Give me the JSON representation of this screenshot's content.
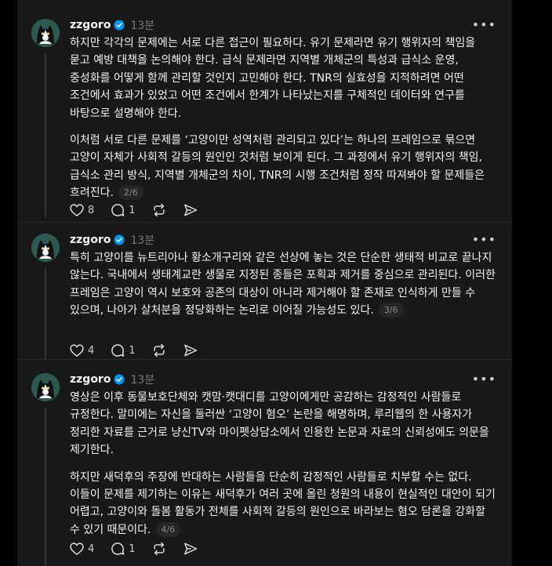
{
  "posts": [
    {
      "username": "zzgoro",
      "time": "13분",
      "paragraphs": [
        "하지만 각각의 문제에는 서로 다른 접근이 필요하다. 유기 문제라면 유기 행위자의 책임을 묻고 예방 대책을 논의해야 한다. 급식 문제라면 지역별 개체군의 특성과 급식소 운영, 중성화를 어떻게 함께 관리할 것인지 고민해야 한다. TNR의 실효성을 지적하려면 어떤 조건에서 효과가 있었고 어떤 조건에서 한계가 나타났는지를 구체적인 데이터와 연구를 바탕으로 설명해야 한다.",
        "이처럼 서로 다른 문제를 ‘고양이만 성역처럼 관리되고 있다’는 하나의 프레임으로 묶으면 고양이 자체가 사회적 갈등의 원인인 것처럼 보이게 된다. 그 과정에서 유기 행위자의 책임, 급식소 관리 방식, 지역별 개체군의 차이, TNR의 시행 조건처럼 정작 따져봐야 할 문제들은 흐려진다."
      ],
      "page": "2/6",
      "likes": "8",
      "replies": "1"
    },
    {
      "username": "zzgoro",
      "time": "13분",
      "paragraphs": [
        "특히 고양이를 뉴트리아나 황소개구리와 같은 선상에 놓는 것은 단순한 생태적 비교로 끝나지 않는다. 국내에서 생태계교란 생물로 지정된 종들은 포획과 제거를 중심으로 관리된다. 이러한 프레임은 고양이 역시 보호와 공존의 대상이 아니라 제거해야 할 존재로 인식하게 만들 수 있으며, 나아가 살처분을 정당화하는 논리로 이어질 가능성도 있다."
      ],
      "page": "3/6",
      "likes": "4",
      "replies": "1"
    },
    {
      "username": "zzgoro",
      "time": "13분",
      "paragraphs": [
        "영상은 이후 동물보호단체와 캣맘·캣대디를 고양이에게만 공감하는 감정적인 사람들로 규정한다. 말미에는 자신을 둘러싼 ‘고양이 혐오’ 논란을 해명하며, 루리웹의 한 사용자가 정리한 자료를 근거로 냥신TV와 마이펫상담소에서 인용한 논문과 자료의 신뢰성에도 의문을 제기한다.",
        "하지만 새덕후의 주장에 반대하는 사람들을 단순히 감정적인 사람들로 치부할 수는 없다. 이들이 문제를 제기하는 이유는 새덕후가 여러 곳에 올린 청원의 내용이 현실적인 대안이 되기 어렵고, 고양이와 돌봄 활동가 전체를 사회적 갈등의 원인으로 바라보는 혐오 담론을 강화할 수 있기 때문이다."
      ],
      "page": "4/6",
      "likes": "4",
      "replies": "1"
    }
  ],
  "icons": {
    "avatar": "cat-avatar-icon",
    "verified": "verified-badge-icon",
    "more": "more-options-icon",
    "like": "heart-icon",
    "reply": "comment-icon",
    "repost": "repost-icon",
    "share": "send-icon"
  },
  "colors": {
    "background": "#181818",
    "text": "#f3f5f7",
    "muted": "#777777",
    "verified": "#0095f6"
  }
}
